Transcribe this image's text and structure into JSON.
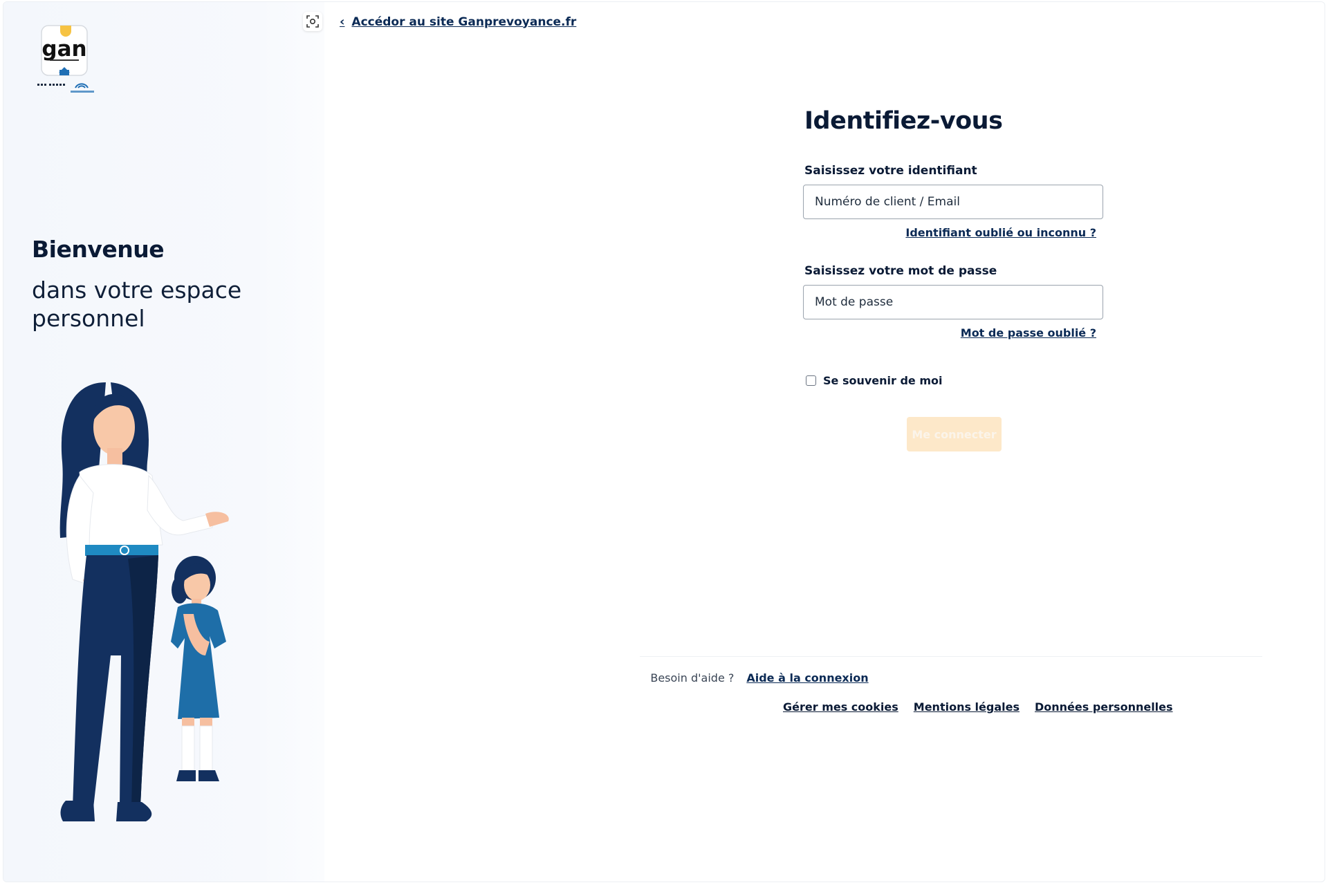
{
  "top": {
    "back_link": "Accédor au site Ganprevoyance.fr"
  },
  "left_panel": {
    "logo_text": "gan",
    "welcome_title": "Bienvenue",
    "welcome_subtitle": "dans votre espace personnel"
  },
  "form": {
    "title": "Identifiez-vous",
    "identifier_label": "Saisissez votre identifiant",
    "identifier_placeholder": "Numéro de client / Email",
    "identifier_forgot": "Identifiant oublié ou inconnu ?",
    "password_label": "Saisissez votre mot de passe",
    "password_placeholder": "Mot de passe",
    "password_forgot": "Mot de passe oublié ?",
    "remember_label": "Se souvenir de moi",
    "remember_checked": false,
    "submit_label": "Me connecter"
  },
  "footer": {
    "help_text": "Besoin d'aide ?",
    "help_link": "Aide à la connexion",
    "links": [
      "Gérer mes cookies",
      "Mentions légales",
      "Données personnelles"
    ]
  },
  "colors": {
    "navy": "#0a1a35",
    "link": "#0b2a55",
    "button_disabled": "#fde8c9",
    "accent_yellow": "#f6c343",
    "accent_blue": "#1f6fb5"
  },
  "icons": [
    "screenshot-icon",
    "chevron-left-icon"
  ]
}
